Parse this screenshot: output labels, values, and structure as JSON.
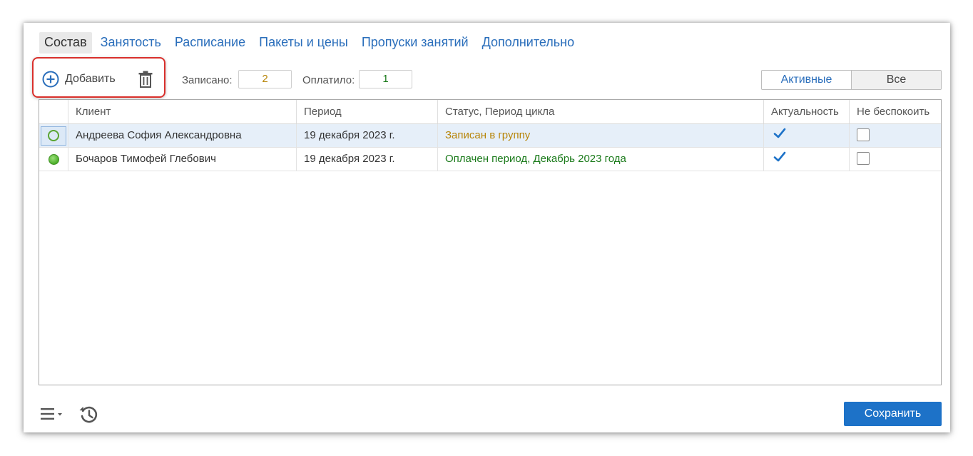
{
  "tabs": [
    {
      "label": "Состав",
      "active": true
    },
    {
      "label": "Занятость",
      "active": false
    },
    {
      "label": "Расписание",
      "active": false
    },
    {
      "label": "Пакеты и цены",
      "active": false
    },
    {
      "label": "Пропуски занятий",
      "active": false
    },
    {
      "label": "Дополнительно",
      "active": false
    }
  ],
  "toolbar": {
    "add_label": "Добавить",
    "enrolled_label": "Записано:",
    "enrolled_value": "2",
    "paid_label": "Оплатило:",
    "paid_value": "1",
    "filter_active": "Активные",
    "filter_all": "Все"
  },
  "table": {
    "columns": [
      "",
      "Клиент",
      "Период",
      "Статус, Период цикла",
      "Актуальность",
      "Не беспокоить"
    ],
    "rows": [
      {
        "status_icon": "circle-outline-icon",
        "client": "Андреева София Александровна",
        "period": "19 декабря 2023 г.",
        "status": "Записан в группу",
        "status_color": "#b8860b",
        "actual": true,
        "do_not_disturb": false,
        "selected": true
      },
      {
        "status_icon": "circle-filled-icon",
        "client": "Бочаров Тимофей Глебович",
        "period": "19 декабря 2023 г.",
        "status": "Оплачен период, Декабрь 2023 года",
        "status_color": "#1a7a1a",
        "actual": true,
        "do_not_disturb": false,
        "selected": false
      }
    ]
  },
  "footer": {
    "save_label": "Сохранить"
  },
  "colors": {
    "accent": "#1d72c8",
    "link": "#2a6ebb",
    "highlight": "#d9302c",
    "enrolled": "#b8860b",
    "paid": "#1a7a1a"
  }
}
